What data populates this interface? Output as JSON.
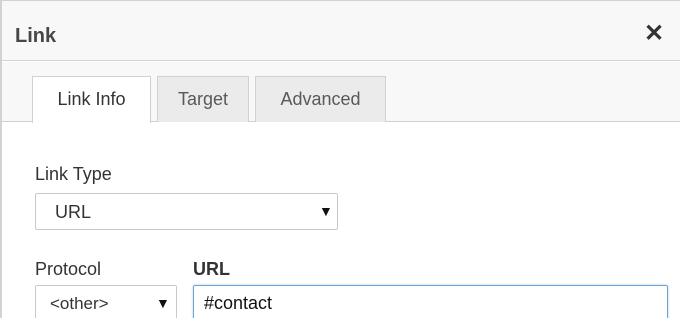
{
  "dialog": {
    "title": "Link",
    "close_icon": "close-icon"
  },
  "tabs": [
    {
      "label": "Link Info",
      "active": true
    },
    {
      "label": "Target",
      "active": false
    },
    {
      "label": "Advanced",
      "active": false
    }
  ],
  "form": {
    "link_type": {
      "label": "Link Type",
      "value": "URL"
    },
    "protocol": {
      "label": "Protocol",
      "value": "<other>"
    },
    "url": {
      "label": "URL",
      "value": "#contact"
    }
  },
  "colors": {
    "titlebar_bg": "#f8f8f8",
    "input_focus_border": "#6ea5d8"
  }
}
